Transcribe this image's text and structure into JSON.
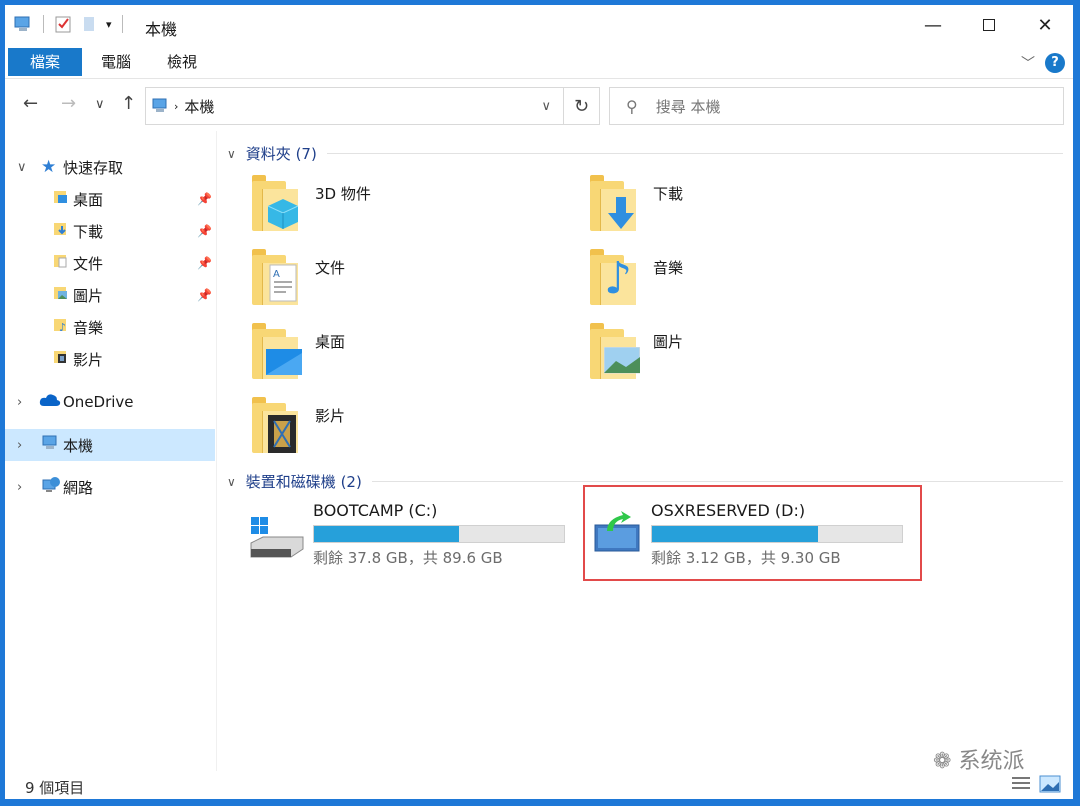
{
  "window": {
    "title": "本機"
  },
  "ribbon": {
    "tabs": [
      "檔案",
      "電腦",
      "檢視"
    ],
    "help": "?"
  },
  "address": {
    "segment": "本機"
  },
  "search": {
    "placeholder": "搜尋 本機"
  },
  "sidebar": {
    "quick_access": "快速存取",
    "quick_items": [
      {
        "label": "桌面",
        "icon": "desktop-icon",
        "pinned": true
      },
      {
        "label": "下載",
        "icon": "downloads-icon",
        "pinned": true
      },
      {
        "label": "文件",
        "icon": "documents-icon",
        "pinned": true
      },
      {
        "label": "圖片",
        "icon": "pictures-icon",
        "pinned": true
      },
      {
        "label": "音樂",
        "icon": "music-icon",
        "pinned": false
      },
      {
        "label": "影片",
        "icon": "videos-icon",
        "pinned": false
      }
    ],
    "onedrive": "OneDrive",
    "this_pc": "本機",
    "network": "網路"
  },
  "content": {
    "folders_header": "資料夾 (7)",
    "folders": [
      "3D 物件",
      "下載",
      "文件",
      "音樂",
      "桌面",
      "圖片",
      "影片"
    ],
    "drives_header": "裝置和磁碟機 (2)",
    "drives": [
      {
        "name": "BOOTCAMP (C:)",
        "info": "剩餘 37.8 GB，共 89.6 GB",
        "used_fraction": 0.578
      },
      {
        "name": "OSXRESERVED (D:)",
        "info": "剩餘 3.12 GB，共 9.30 GB",
        "used_fraction": 0.665
      }
    ]
  },
  "status": {
    "count": "9 個項目"
  },
  "watermark": "系统派",
  "colors": {
    "accent": "#1979ca",
    "drive_bar": "#26a0da",
    "selection": "#cce8ff",
    "highlight_box": "#e24a4a"
  }
}
